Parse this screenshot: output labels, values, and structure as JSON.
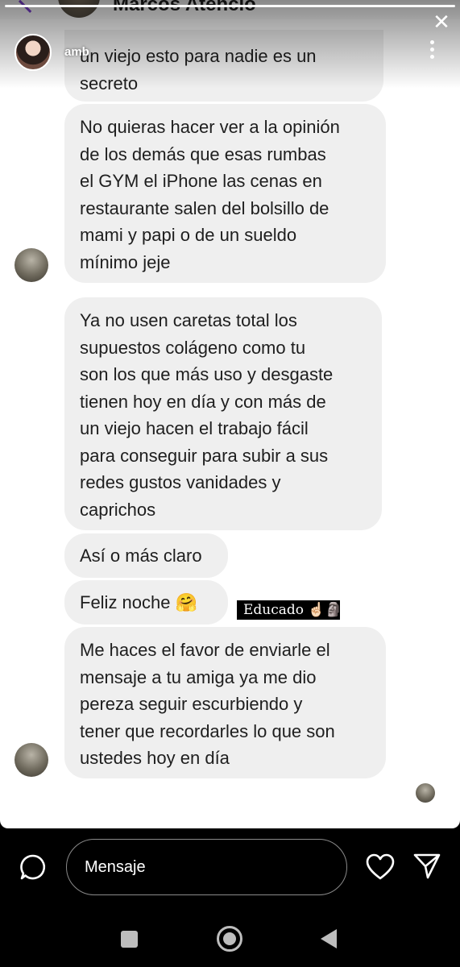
{
  "story": {
    "uploader_name": "amb",
    "dm_header_name": "Marcos Atencio"
  },
  "messages": [
    {
      "text": "un viejo esto para nadie es un\nsecreto"
    },
    {
      "text": "No quieras hacer ver a la opinión\nde los demás que esas rumbas\nel GYM el iPhone las cenas en\nrestaurante salen del bolsillo de\nmami y papi o de un sueldo\nmínimo jeje"
    },
    {
      "text": "Ya no usen caretas total los\nsupuestos colágeno como tu\nson los que más uso y desgaste\ntienen hoy en día y con más de\nun viejo hacen el trabajo fácil\npara conseguir para subir a sus\nredes gustos vanidades y\ncaprichos"
    },
    {
      "text": "Así o más claro"
    },
    {
      "text": "Feliz noche 🤗"
    },
    {
      "text": "Me haces el favor de enviarle el\nmensaje a tu amiga ya me dio\npereza seguir escurbiendo y\ntener que recordarles lo que son\nustedes hoy en día"
    }
  ],
  "sticker": {
    "text": "Educado ☝🏻🗿"
  },
  "reply_bar": {
    "placeholder": "Mensaje"
  },
  "icons": {
    "reply": "chat-bubble-icon",
    "like": "heart-icon",
    "share": "send-icon",
    "close": "close-icon",
    "more": "more-options-icon"
  },
  "colors": {
    "bubble": "#efefef",
    "bar_background": "#000000",
    "back_arrow": "#7a3fd1"
  }
}
